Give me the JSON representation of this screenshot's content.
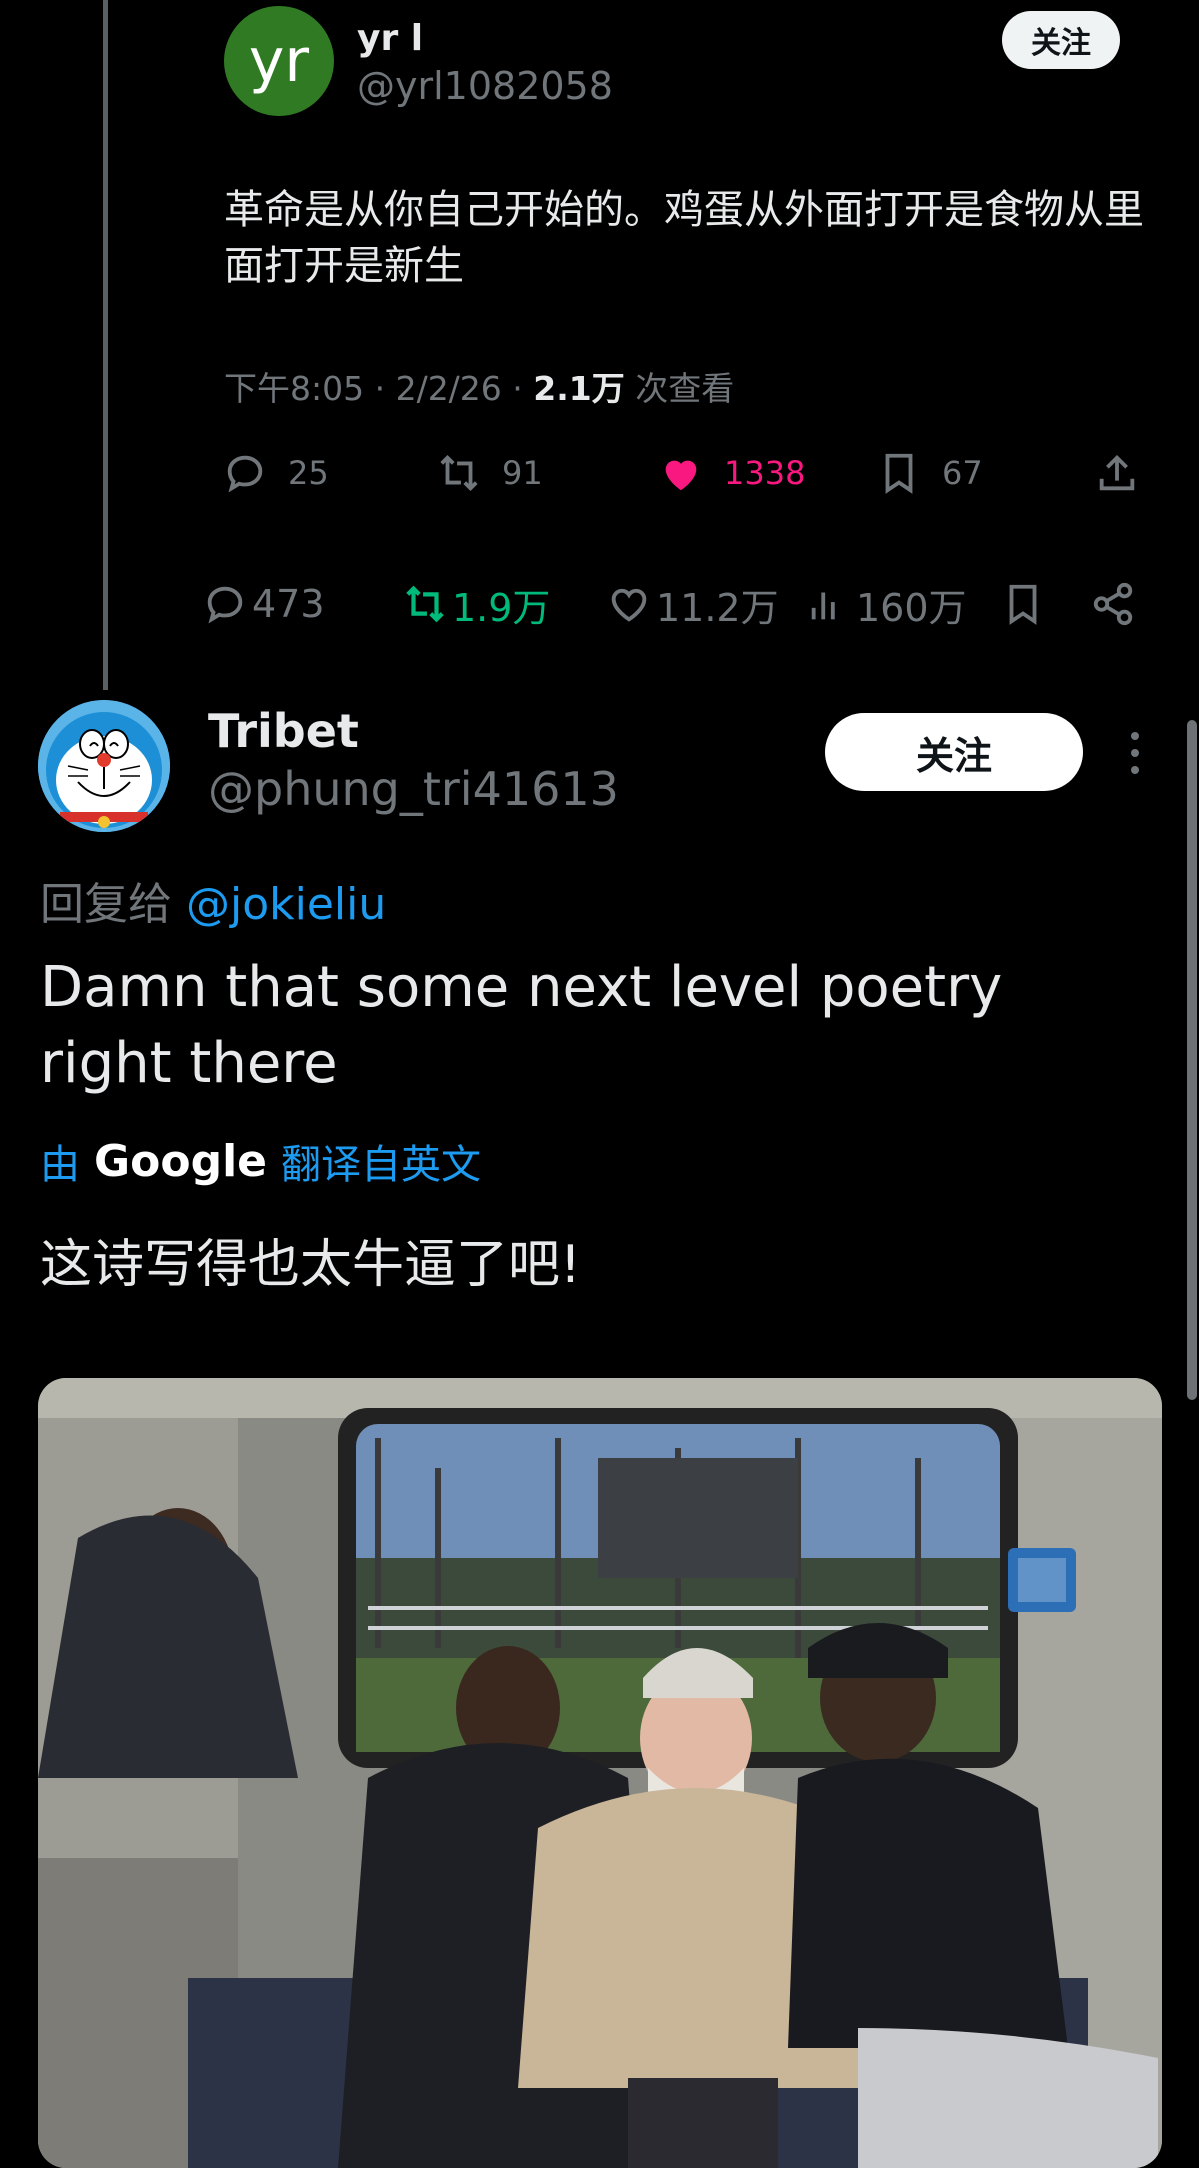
{
  "quoted_tweet": {
    "avatar_text": "yr",
    "name": "yr l",
    "handle": "@yrl1082058",
    "follow_label": "关注",
    "text": "革命是从你自己开始的。鸡蛋从外面打开是食物从里面打开是新生",
    "time": "下午8:05 · 2/2/26 · ",
    "views_count": "2.1万",
    "views_label": " 次查看",
    "stats": {
      "replies": "25",
      "retweets": "91",
      "likes": "1338",
      "bookmarks": "67"
    }
  },
  "original_actions": {
    "replies": "473",
    "retweets": "1.9万",
    "likes": "11.2万",
    "views": "160万"
  },
  "reply": {
    "name": "Tribet",
    "handle": "@phung_tri41613",
    "follow_label": "关注",
    "reply_to_label": "回复给 ",
    "reply_to_mention": "@jokieliu",
    "text": "Damn that some next level poetry right there",
    "translate_prefix": "由",
    "translate_brand": "Google",
    "translate_suffix": "翻译自英文",
    "translation": "这诗写得也太牛逼了吧!"
  },
  "colors": {
    "accent": "#1d9bf0",
    "like": "#f91880",
    "retweet": "#00ba7c",
    "muted": "#71767b"
  },
  "icons": [
    "reply-icon",
    "retweet-icon",
    "heart-icon",
    "bookmark-icon",
    "share-icon",
    "views-icon",
    "share-nodes-icon",
    "more-icon"
  ]
}
